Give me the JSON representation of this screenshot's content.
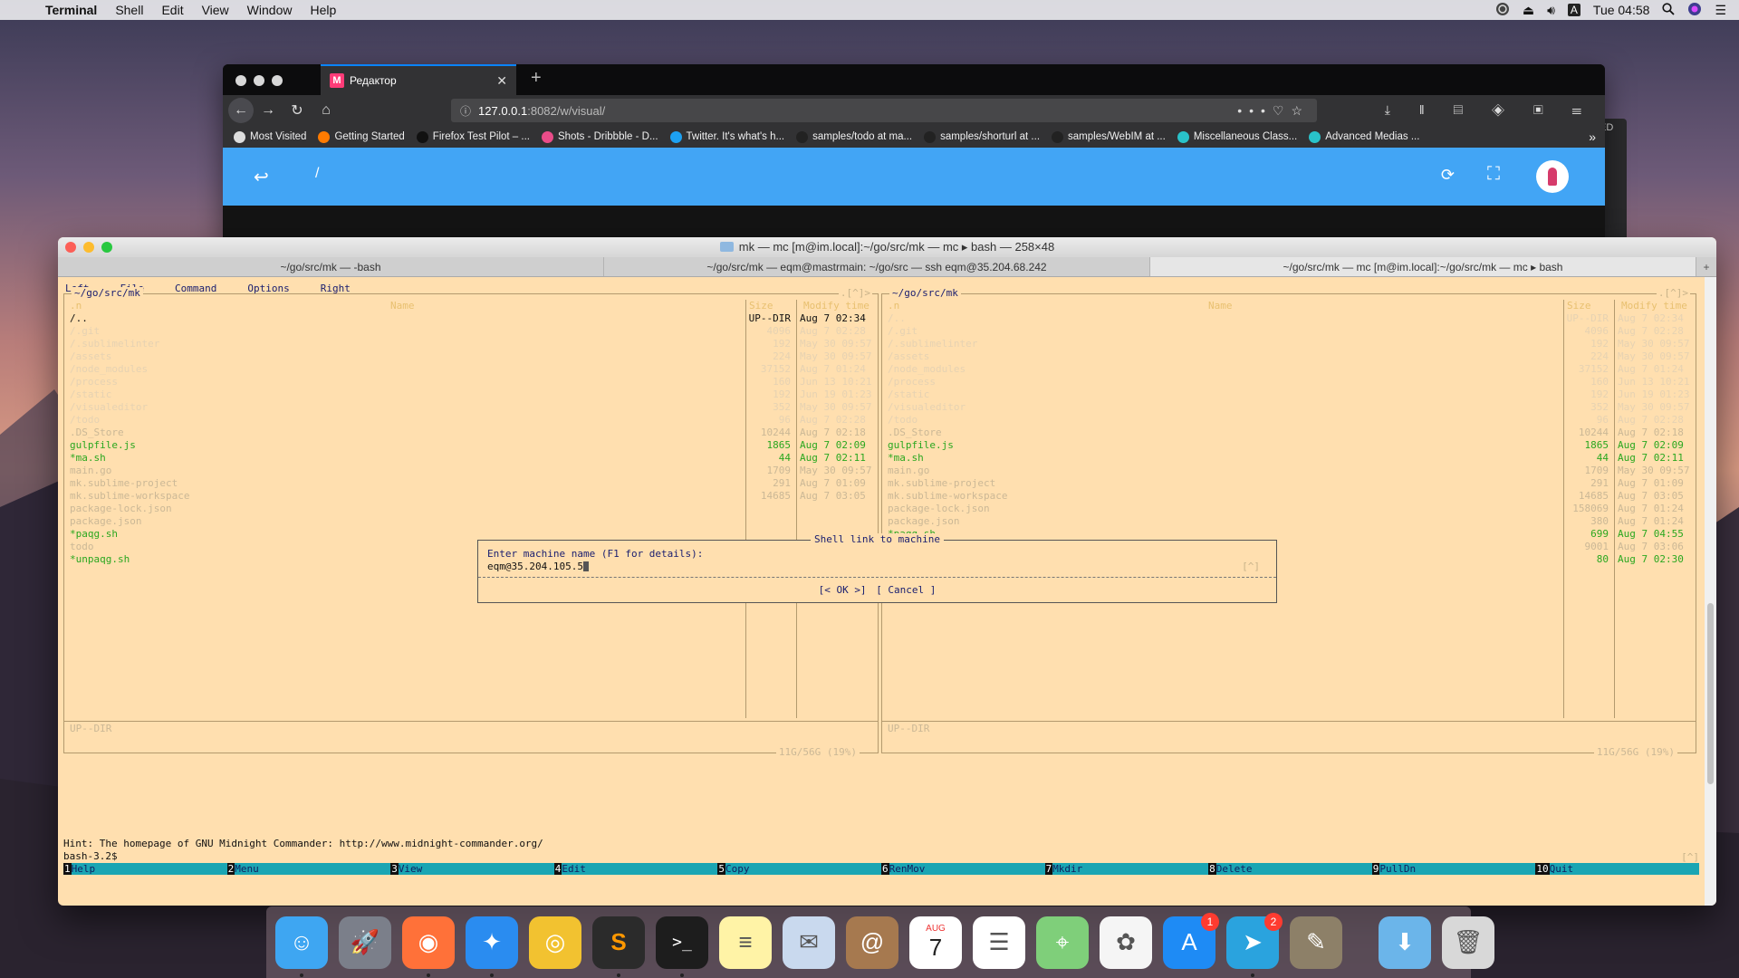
{
  "menubar": {
    "app": "Terminal",
    "items": [
      "Shell",
      "Edit",
      "View",
      "Window",
      "Help"
    ],
    "clock": "Tue 04:58",
    "input_source": "A"
  },
  "firefox": {
    "tab_title": "Редактор",
    "tab_favicon_letter": "M",
    "url_host": "127.0.0.1",
    "url_path": ":8082/w/visual/",
    "bookmarks": [
      {
        "label": "Most Visited",
        "color": "#dddddd"
      },
      {
        "label": "Getting Started",
        "color": "#ff7b00"
      },
      {
        "label": "Firefox Test Pilot – ...",
        "color": "#111111"
      },
      {
        "label": "Shots - Dribbble - D...",
        "color": "#ea4c89"
      },
      {
        "label": "Twitter. It's what's h...",
        "color": "#1da1f2"
      },
      {
        "label": "samples/todo at ma...",
        "color": "#222222"
      },
      {
        "label": "samples/shorturl at ...",
        "color": "#222222"
      },
      {
        "label": "samples/WebIM at ...",
        "color": "#222222"
      },
      {
        "label": "Miscellaneous Class...",
        "color": "#29c2c9"
      },
      {
        "label": "Advanced Medias ...",
        "color": "#29c2c9"
      }
    ],
    "page_path": "/",
    "side_label": "ED"
  },
  "terminal": {
    "title": "mk — mc [m@im.local]:~/go/src/mk — mc ▸ bash — 258×48",
    "tabs": [
      {
        "label": "~/go/src/mk — -bash",
        "active": false
      },
      {
        "label": "~/go/src/mk — eqm@mastrmain: ~/go/src — ssh eqm@35.204.68.242",
        "active": false
      },
      {
        "label": "~/go/src/mk — mc [m@im.local]:~/go/src/mk — mc ▸ bash",
        "active": true
      }
    ],
    "mc_menu": [
      "Left",
      "File",
      "Command",
      "Options",
      "Right"
    ],
    "left_panel": {
      "path": "~/go/src/mk",
      "corner": ".[^]>",
      "header": {
        "name_col": ".n",
        "name": "Name",
        "size": "Size",
        "modify": "Modify time"
      },
      "rows": [
        {
          "name": "/..",
          "size": "UP--DIR",
          "date": "Aug  7 02:34",
          "kind": "up"
        },
        {
          "name": "/.git",
          "size": "4096",
          "date": "Aug  7 02:28",
          "kind": "hidden"
        },
        {
          "name": "/.sublimelinter",
          "size": "192",
          "date": "May 30 09:57",
          "kind": "hidden"
        },
        {
          "name": "/assets",
          "size": "224",
          "date": "May 30 09:57",
          "kind": "hidden"
        },
        {
          "name": "/node_modules",
          "size": "37152",
          "date": "Aug  7 01:24",
          "kind": "hidden"
        },
        {
          "name": "/process",
          "size": "160",
          "date": "Jun 13 10:21",
          "kind": "hidden"
        },
        {
          "name": "/static",
          "size": "192",
          "date": "Jun 19 01:23",
          "kind": "hidden"
        },
        {
          "name": "/visualeditor",
          "size": "352",
          "date": "May 30 09:57",
          "kind": "hidden"
        },
        {
          "name": "/todo",
          "size": "96",
          "date": "Aug  7 02:28",
          "kind": "hidden"
        },
        {
          "name": ".DS_Store",
          "size": "10244",
          "date": "Aug  7 02:18",
          "kind": "faint"
        },
        {
          "name": "gulpfile.js",
          "size": "1865",
          "date": "Aug  7 02:09",
          "kind": "js"
        },
        {
          "name": "*ma.sh",
          "size": "44",
          "date": "Aug  7 02:11",
          "kind": "exe"
        },
        {
          "name": "main.go",
          "size": "1709",
          "date": "May 30 09:57",
          "kind": "faint"
        },
        {
          "name": "mk.sublime-project",
          "size": "291",
          "date": "Aug  7 01:09",
          "kind": "faint"
        },
        {
          "name": "mk.sublime-workspace",
          "size": "14685",
          "date": "Aug  7 03:05",
          "kind": "faint"
        },
        {
          "name": "package-lock.json",
          "size": "",
          "date": "",
          "kind": "faint"
        },
        {
          "name": "package.json",
          "size": "",
          "date": "",
          "kind": "faint"
        },
        {
          "name": "*paqg.sh",
          "size": "",
          "date": "",
          "kind": "exe"
        },
        {
          "name": "todo",
          "size": "",
          "date": "",
          "kind": "faint"
        },
        {
          "name": "*unpaqg.sh",
          "size": "",
          "date": "",
          "kind": "exe"
        }
      ],
      "status": "UP--DIR",
      "free": "11G/56G (19%)"
    },
    "right_panel": {
      "path": "~/go/src/mk",
      "corner": ".[^]>",
      "header": {
        "name_col": ".n",
        "name": "Name",
        "size": "Size",
        "modify": "Modify time"
      },
      "rows": [
        {
          "name": "/..",
          "size": "UP--DIR",
          "date": "Aug  7 02:34",
          "kind": "hidden"
        },
        {
          "name": "/.git",
          "size": "4096",
          "date": "Aug  7 02:28",
          "kind": "hidden"
        },
        {
          "name": "/.sublimelinter",
          "size": "192",
          "date": "May 30 09:57",
          "kind": "hidden"
        },
        {
          "name": "/assets",
          "size": "224",
          "date": "May 30 09:57",
          "kind": "hidden"
        },
        {
          "name": "/node_modules",
          "size": "37152",
          "date": "Aug  7 01:24",
          "kind": "hidden"
        },
        {
          "name": "/process",
          "size": "160",
          "date": "Jun 13 10:21",
          "kind": "hidden"
        },
        {
          "name": "/static",
          "size": "192",
          "date": "Jun 19 01:23",
          "kind": "hidden"
        },
        {
          "name": "/visualeditor",
          "size": "352",
          "date": "May 30 09:57",
          "kind": "hidden"
        },
        {
          "name": "/todo",
          "size": "96",
          "date": "Aug  7 02:28",
          "kind": "hidden"
        },
        {
          "name": ".DS_Store",
          "size": "10244",
          "date": "Aug  7 02:18",
          "kind": "faint"
        },
        {
          "name": "gulpfile.js",
          "size": "1865",
          "date": "Aug  7 02:09",
          "kind": "js"
        },
        {
          "name": "*ma.sh",
          "size": "44",
          "date": "Aug  7 02:11",
          "kind": "exe"
        },
        {
          "name": "main.go",
          "size": "1709",
          "date": "May 30 09:57",
          "kind": "faint"
        },
        {
          "name": "mk.sublime-project",
          "size": "291",
          "date": "Aug  7 01:09",
          "kind": "faint"
        },
        {
          "name": "mk.sublime-workspace",
          "size": "14685",
          "date": "Aug  7 03:05",
          "kind": "faint"
        },
        {
          "name": "package-lock.json",
          "size": "158069",
          "date": "Aug  7 01:24",
          "kind": "faint"
        },
        {
          "name": "package.json",
          "size": "380",
          "date": "Aug  7 01:24",
          "kind": "faint"
        },
        {
          "name": "*paqg.sh",
          "size": "699",
          "date": "Aug  7 04:55",
          "kind": "exe"
        },
        {
          "name": "todo",
          "size": "9001",
          "date": "Aug  7 03:06",
          "kind": "faint"
        },
        {
          "name": "*unpaqg.sh",
          "size": "80",
          "date": "Aug  7 02:30",
          "kind": "exe"
        }
      ],
      "status": "UP--DIR",
      "free": "11G/56G (19%)"
    },
    "dialog": {
      "title": "Shell link to machine",
      "prompt": "Enter machine name (F1 for details):",
      "value": "eqm@35.204.105.5",
      "history": "[^]",
      "ok": "[< OK >]",
      "cancel": "[ Cancel ]"
    },
    "hint": "Hint: The homepage of GNU Midnight Commander: http://www.midnight-commander.org/",
    "prompt": "bash-3.2$",
    "scroll_indicator": "[^]",
    "fkeys": [
      {
        "num": "1",
        "label": "Help"
      },
      {
        "num": "2",
        "label": "Menu"
      },
      {
        "num": "3",
        "label": "View"
      },
      {
        "num": "4",
        "label": "Edit"
      },
      {
        "num": "5",
        "label": "Copy"
      },
      {
        "num": "6",
        "label": "RenMov"
      },
      {
        "num": "7",
        "label": "Mkdir"
      },
      {
        "num": "8",
        "label": "Delete"
      },
      {
        "num": "9",
        "label": "PullDn"
      },
      {
        "num": "10",
        "label": "Quit"
      }
    ]
  },
  "dock": {
    "apps": [
      {
        "icon": "finder-icon",
        "color": "#3ea6f2",
        "running": true,
        "glyph": "☺"
      },
      {
        "icon": "launchpad-icon",
        "color": "#7b7f8a",
        "running": false,
        "glyph": "🚀"
      },
      {
        "icon": "firefox-icon",
        "color": "#ff7139",
        "running": true,
        "glyph": "◉"
      },
      {
        "icon": "safari-icon",
        "color": "#2a8cf0",
        "running": true,
        "glyph": "✦"
      },
      {
        "icon": "chrome-icon",
        "color": "#f2c230",
        "running": false,
        "glyph": "◎"
      },
      {
        "icon": "sublime-text-icon",
        "color": "#2b2b2b",
        "running": true,
        "glyph": "S"
      },
      {
        "icon": "terminal-icon",
        "color": "#1d1d1d",
        "running": true,
        "glyph": ">_"
      },
      {
        "icon": "notes-icon",
        "color": "#fff3a6",
        "running": false,
        "glyph": "≡"
      },
      {
        "icon": "mail-stamp-icon",
        "color": "#c9d9ee",
        "running": false,
        "glyph": "✉"
      },
      {
        "icon": "contacts-icon",
        "color": "#a6794f",
        "running": false,
        "glyph": "@"
      },
      {
        "icon": "calendar-icon",
        "color": "#ffffff",
        "running": false,
        "glyph": "7"
      },
      {
        "icon": "reminders-icon",
        "color": "#ffffff",
        "running": false,
        "glyph": "☰"
      },
      {
        "icon": "maps-icon",
        "color": "#7fcf7a",
        "running": false,
        "glyph": "⌖"
      },
      {
        "icon": "photos-icon",
        "color": "#f5f5f5",
        "running": false,
        "glyph": "✿"
      },
      {
        "icon": "app-store-icon",
        "color": "#1e8bf5",
        "running": false,
        "glyph": "A",
        "badge": "1"
      },
      {
        "icon": "telegram-icon",
        "color": "#2aa3de",
        "running": true,
        "glyph": "➤",
        "badge": "2"
      },
      {
        "icon": "gimp-icon",
        "color": "#8d8068",
        "running": false,
        "glyph": "✎"
      }
    ],
    "calendar_month": "AUG",
    "calendar_day": "7",
    "stack": [
      {
        "icon": "downloads-folder-icon",
        "color": "#6bb5ea",
        "glyph": "⬇"
      },
      {
        "icon": "trash-icon",
        "color": "#d8d8d8",
        "glyph": "🗑"
      }
    ]
  }
}
